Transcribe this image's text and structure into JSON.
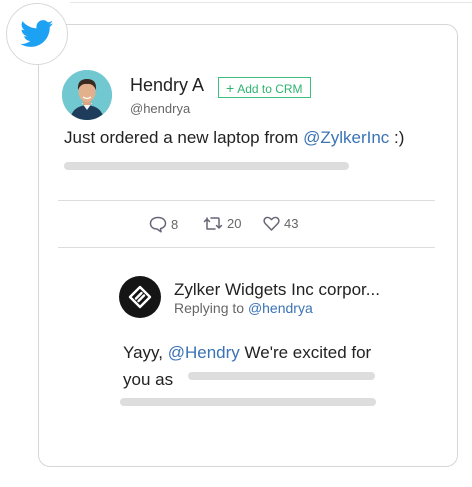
{
  "tweet": {
    "author_name": "Hendry A",
    "author_handle": "@hendrya",
    "crm_button_label": "Add to CRM",
    "text_prefix": "Just ordered a new laptop from ",
    "text_mention": "@ZylkerInc",
    "text_suffix": " :)",
    "stats": {
      "comments": "8",
      "retweets": "20",
      "likes": "43"
    }
  },
  "reply": {
    "author_name": "Zylker Widgets Inc corpor...",
    "replying_label": "Replying to",
    "replying_handle": "@hendrya",
    "text_prefix": "Yayy, ",
    "text_mention": "@Hendry",
    "text_line1_suffix": " We're excited for",
    "text_line2": "you as"
  },
  "colors": {
    "twitter_blue": "#1da1f2",
    "mention": "#3a73b6",
    "crm_green": "#2fb36f",
    "skeleton": "#dddddd"
  },
  "icons": {
    "badge": "twitter-bird-icon",
    "comments": "comment-icon",
    "retweets": "retweet-icon",
    "likes": "heart-icon"
  }
}
